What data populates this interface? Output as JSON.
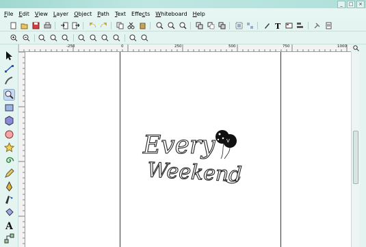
{
  "menubar": {
    "items": [
      {
        "label": "File",
        "accel": "F",
        "rest": "ile"
      },
      {
        "label": "Edit",
        "accel": "E",
        "rest": "dit"
      },
      {
        "label": "View",
        "accel": "V",
        "rest": "iew"
      },
      {
        "label": "Layer",
        "accel": "L",
        "rest": "ayer"
      },
      {
        "label": "Object",
        "accel": "O",
        "rest": "bject"
      },
      {
        "label": "Path",
        "accel": "P",
        "rest": "ath"
      },
      {
        "label": "Text",
        "accel": "T",
        "rest": "ext"
      },
      {
        "label": "Effects",
        "accel": "c",
        "rest_before": "Effe",
        "rest": "ts"
      },
      {
        "label": "Whiteboard",
        "accel": "W",
        "rest": "hiteboard"
      },
      {
        "label": "Help",
        "accel": "H",
        "rest": "elp"
      }
    ]
  },
  "toolbar1_icons": [
    "new-document-icon",
    "open-icon",
    "save-icon",
    "print-icon",
    "import-icon",
    "export-icon",
    "undo-icon",
    "redo-icon",
    "copy-icon",
    "cut-icon",
    "paste-icon",
    "zoom-selection-icon",
    "zoom-drawing-icon",
    "zoom-page-icon",
    "duplicate-icon",
    "clone-icon",
    "unlink-clone-icon",
    "group-icon",
    "ungroup-icon",
    "fill-stroke-icon",
    "text-font-icon",
    "xml-editor-icon",
    "align-distribute-icon",
    "preferences-icon",
    "document-properties-icon"
  ],
  "toolbar2_icons": [
    "zoom-in-icon",
    "zoom-out-icon",
    "zoom-1-1-icon",
    "zoom-1-2-icon",
    "zoom-2-1-icon",
    "zoom-fit-selection-icon",
    "zoom-fit-drawing-icon",
    "zoom-fit-page-icon",
    "zoom-fit-width-icon",
    "zoom-previous-icon",
    "zoom-next-icon"
  ],
  "toolbox_tools": [
    "selector-tool",
    "node-tool",
    "tweak-tool",
    "zoom-tool",
    "rectangle-tool",
    "3d-box-tool",
    "ellipse-tool",
    "star-tool",
    "spiral-tool",
    "pencil-tool",
    "pen-tool",
    "calligraphy-tool",
    "paint-bucket-tool",
    "text-tool",
    "connector-tool"
  ],
  "ruler": {
    "top_labels": [
      "-250",
      "0",
      "250",
      "500",
      "750",
      "1000"
    ],
    "left_labels": []
  },
  "artwork": {
    "line1": "Every",
    "line2": "Weekend",
    "badge_text": "V"
  },
  "colors": {
    "title_bar": "#aee0d9",
    "menu_bg": "#e6f6f3",
    "toolbar_bg": "#e3f4f1",
    "active_tool": "#c5d9f2"
  }
}
